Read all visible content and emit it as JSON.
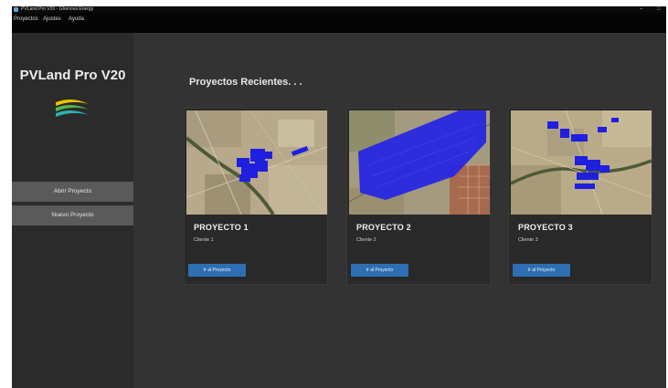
{
  "window": {
    "title": "PVLand Pro V20 - Ghenova Energy",
    "minimize_glyph": "–",
    "maximize_glyph": "□"
  },
  "menu": [
    "Proyectos",
    "Ajustes",
    "Ayuda"
  ],
  "sidebar": {
    "brand": "PVLand Pro V20",
    "buttons": [
      "Abrir Proyecto",
      "Nuevo Proyecto"
    ]
  },
  "main": {
    "heading": "Proyectos Recientes. . .",
    "projects": [
      {
        "title": "PROYECTO 1",
        "client": "Cliente 1",
        "button": "Ir al Proyecto"
      },
      {
        "title": "PROYECTO 2",
        "client": "Cliente 2",
        "button": "Ir al Proyecto"
      },
      {
        "title": "PROYECTO 3",
        "client": "Cliente 3",
        "button": "Ir al Proyecto"
      }
    ]
  },
  "colors": {
    "accent": "#2e6fb3",
    "panel_blue": "#1f1fe0",
    "sidebar_bg": "#2b2b2b",
    "main_bg": "#333333"
  }
}
